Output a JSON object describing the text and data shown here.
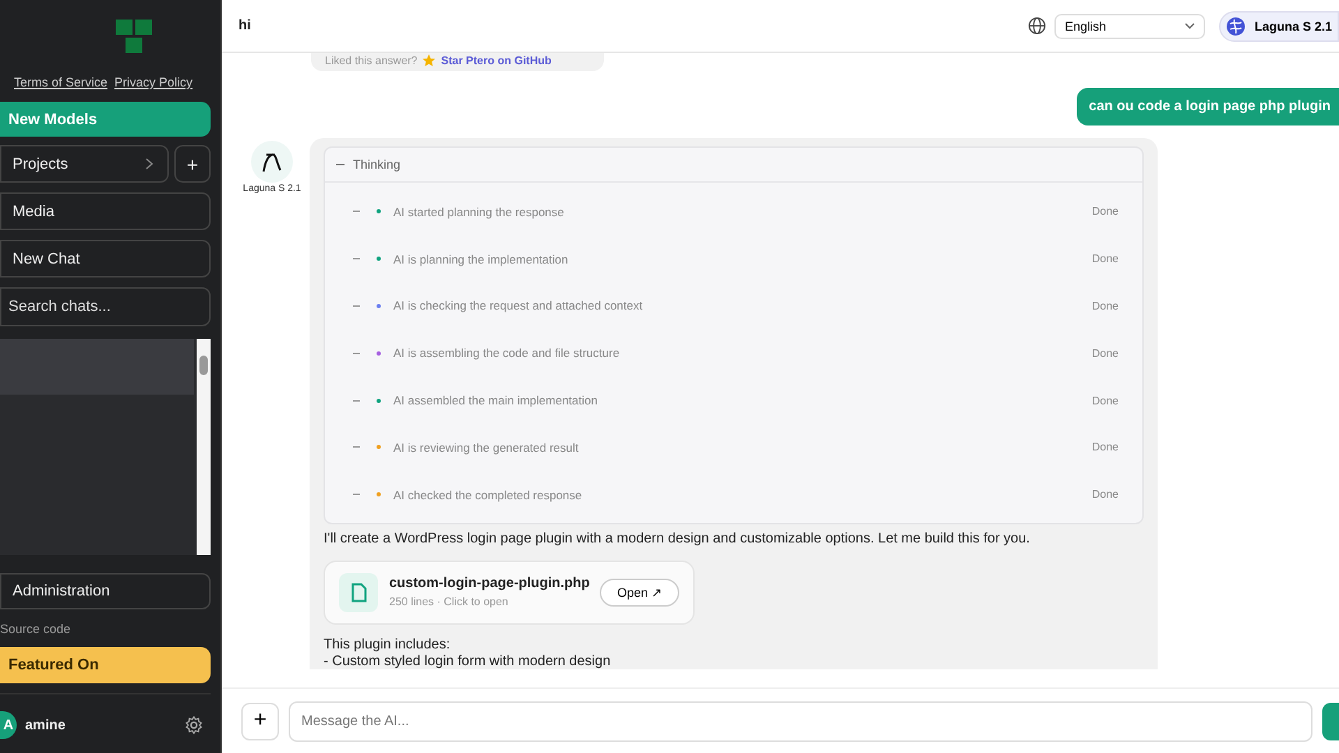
{
  "sidebar": {
    "links": [
      "Terms of Service",
      "Privacy Policy"
    ],
    "new_models": "New Models",
    "projects": {
      "label": "Projects",
      "add": "+"
    },
    "media": "Media",
    "new_chat": "New Chat",
    "search": {
      "placeholder": "Search chats..."
    },
    "administration": "Administration",
    "source_code": "Source code",
    "featured": "Featured On",
    "user": {
      "initial": "A",
      "name": "amine"
    }
  },
  "header": {
    "title": "hi",
    "language": "English",
    "model": "Laguna S 2.1"
  },
  "feedback": {
    "prompt": "Liked this answer?",
    "link": "Star Ptero on GitHub"
  },
  "user_message": "can ou code a login page php plugin",
  "assistant": {
    "name": "Laguna S 2.1",
    "thinking": {
      "title": "Thinking",
      "expanded": true,
      "steps": [
        {
          "text": "AI started planning the response",
          "status": "Done",
          "color": "#10a37f"
        },
        {
          "text": "AI is planning the implementation",
          "status": "Done",
          "color": "#10a37f"
        },
        {
          "text": "AI is checking the request and attached context",
          "status": "Done",
          "color": "#6b7ff0"
        },
        {
          "text": "AI is assembling the code and file structure",
          "status": "Done",
          "color": "#a65fe0"
        },
        {
          "text": "AI assembled the main implementation",
          "status": "Done",
          "color": "#10a37f"
        },
        {
          "text": "AI is reviewing the generated result",
          "status": "Done",
          "color": "#f0a020"
        },
        {
          "text": "AI checked the completed response",
          "status": "Done",
          "color": "#f0a020"
        }
      ]
    },
    "intro": "I'll create a WordPress login page plugin with a modern design and customizable options. Let me build this for you.",
    "file": {
      "name": "custom-login-page-plugin.php",
      "meta": "250 lines · Click to open",
      "action": "Open ↗"
    },
    "includes_title": "This plugin includes:",
    "includes": [
      "- Custom styled login form with modern design"
    ]
  },
  "composer": {
    "add": "+",
    "placeholder": "Message the AI..."
  }
}
